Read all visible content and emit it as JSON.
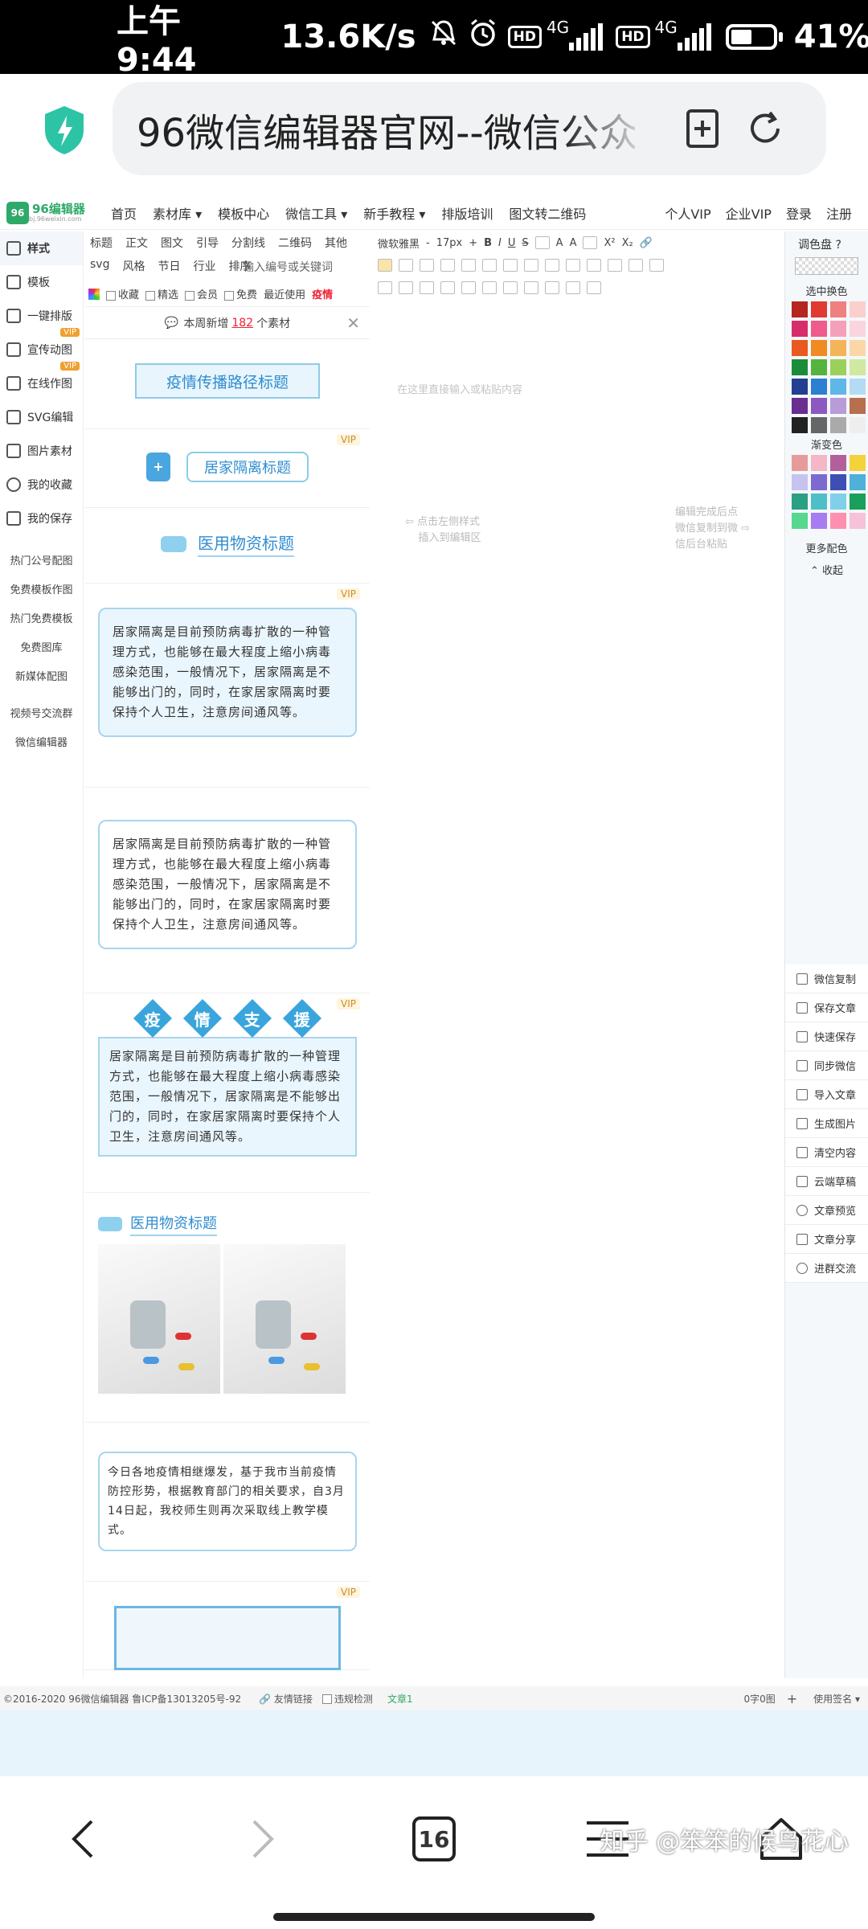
{
  "status": {
    "time": "上午9:44",
    "speed": "13.6K/s",
    "net1": "4G",
    "net2": "4G",
    "battery": "41%",
    "hd": "HD"
  },
  "browser": {
    "url": "96微信编辑器官网--微信公众平"
  },
  "nav": {
    "logo": "96编辑器",
    "logo_sub": "bj.96weixin.com",
    "items": [
      "首页",
      "素材库 ▾",
      "模板中心",
      "微信工具 ▾",
      "新手教程 ▾",
      "排版培训",
      "图文转二维码"
    ],
    "right": [
      "个人VIP",
      "企业VIP",
      "登录",
      "注册"
    ]
  },
  "left_nav": {
    "main": [
      {
        "label": "样式"
      },
      {
        "label": "模板"
      },
      {
        "label": "一键排版"
      },
      {
        "label": "宣传动图",
        "vip": "VIP"
      },
      {
        "label": "在线作图",
        "vip": "VIP"
      },
      {
        "label": "SVG编辑"
      },
      {
        "label": "图片素材"
      },
      {
        "label": "我的收藏"
      },
      {
        "label": "我的保存"
      }
    ],
    "secondary": [
      "热门公号配图",
      "免费模板作图",
      "热门免费模板",
      "免费图库",
      "新媒体配图",
      "视频号交流群",
      "微信编辑器"
    ]
  },
  "categories": [
    "标题",
    "正文",
    "图文",
    "引导",
    "分割线",
    "二维码",
    "其他",
    "svg",
    "风格",
    "节日",
    "行业",
    "排序"
  ],
  "search_placeholder": "输入编号或关键词",
  "filters": [
    "收藏",
    "精选",
    "会员",
    "免费",
    "最近使用",
    "疫情"
  ],
  "notice": {
    "prefix": "本周新增",
    "count": "182",
    "suffix": "个素材"
  },
  "vip": "VIP",
  "cards": {
    "t1": "疫情传播路径标题",
    "t2": "居家隔离标题",
    "t3": "医用物资标题",
    "para": "居家隔离是目前预防病毒扩散的一种管理方式，也能够在最大程度上缩小病毒感染范围，一般情况下，居家隔离是不能够出门的，同时，在家居家隔离时要保持个人卫生，注意房间通风等。",
    "diamonds": [
      "疫",
      "情",
      "支",
      "援"
    ],
    "t4": "医用物资标题",
    "notice_text": "今日各地疫情相继爆发，基于我市当前疫情防控形势，根据教育部门的相关要求，自3月14日起，我校师生则再次采取线上教学模式。"
  },
  "editor": {
    "font": "微软雅黑",
    "size": "17px",
    "placeholder": "在这里直接输入或粘贴内容",
    "hint_left1": "点击左侧样式",
    "hint_left2": "插入到编辑区",
    "hint_right1": "编辑完成后点",
    "hint_right2": "微信复制到微",
    "hint_right3": "信后台粘贴"
  },
  "palette": {
    "title": "调色盘",
    "select": "选中换色",
    "gradient": "渐变色",
    "more": "更多配色",
    "collapse": "收起",
    "colors": [
      "#b4261f",
      "#e13a30",
      "#f08080",
      "#fbd0cc",
      "#d82d6b",
      "#ee5b8c",
      "#f5a0bb",
      "#fad5df",
      "#e85a1f",
      "#f08a22",
      "#f5b35a",
      "#fbd7a8",
      "#1b8c39",
      "#56b33d",
      "#9bd05a",
      "#cfe9a0",
      "#233f8f",
      "#2c7fd1",
      "#5fb7e8",
      "#b3dcf4",
      "#6a2d90",
      "#8d58bf",
      "#b99bd8",
      "#b86f4c",
      "#222222",
      "#666666",
      "#aaaaaa",
      "#eeeeee"
    ],
    "gradients": [
      "#e89a9a",
      "#f4b7c6",
      "#b35f9a",
      "#f3d33a",
      "#c6c3f0",
      "#7d6ad0",
      "#3d4fb5",
      "#4fb0d9",
      "#2aa084",
      "#4fbfc7",
      "#7fd0e8",
      "#19a05a",
      "#56d88f",
      "#a77cf0",
      "#ff8fb0",
      "#f7c2d9"
    ]
  },
  "actions": [
    "微信复制",
    "保存文章",
    "快速保存",
    "同步微信",
    "导入文章",
    "生成图片",
    "清空内容",
    "云端草稿",
    "文章预览",
    "文章分享",
    "进群交流"
  ],
  "footer": {
    "copyright": "©2016-2020 96微信编辑器 鲁ICP备13013205号-92",
    "link": "友情链接",
    "check": "违规检测",
    "doc": "文章1",
    "count": "0字0图",
    "sign": "使用签名 ▾"
  },
  "bottom": {
    "tabs": "16",
    "watermark": "知乎 @笨笨的候鸟花心"
  }
}
